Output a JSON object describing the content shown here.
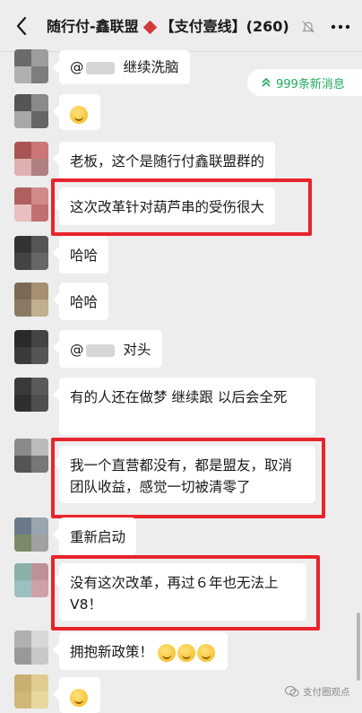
{
  "header": {
    "title_part1": "随行付-鑫联盟",
    "title_part2": "【支付壹线】(260)"
  },
  "new_messages": {
    "label": "999条新消息"
  },
  "messages": [
    {
      "mention_text": "@",
      "text": "继续洗脑"
    },
    {
      "emoji": "thinking-face"
    },
    {
      "text": "老板，这个是随行付鑫联盟群的"
    },
    {
      "text": "这次改革针对葫芦串的受伤很大",
      "highlighted": true
    },
    {
      "text": "哈哈"
    },
    {
      "text": "哈哈"
    },
    {
      "mention_text": "@",
      "text": "对头"
    },
    {
      "text": "有的人还在做梦 继续跟  以后会全死"
    },
    {
      "text": "我一个直营都没有，都是盟友，取消团队收益，感觉一切被清零了",
      "highlighted": true
    },
    {
      "text": "重新启动"
    },
    {
      "text": "没有这次改革，再过６年也无法上V8！",
      "highlighted": true
    },
    {
      "text": "拥抱新政策！",
      "emoji": "worried-face x3"
    },
    {
      "emoji": "persevering-face"
    }
  ],
  "watermark": {
    "text": "支付圈观点"
  },
  "colors": {
    "background": "#ededed",
    "bubble": "#ffffff",
    "highlight_border": "#e8242c",
    "accent_green": "#1aad5b",
    "title_diamond": "#d23b3b"
  }
}
